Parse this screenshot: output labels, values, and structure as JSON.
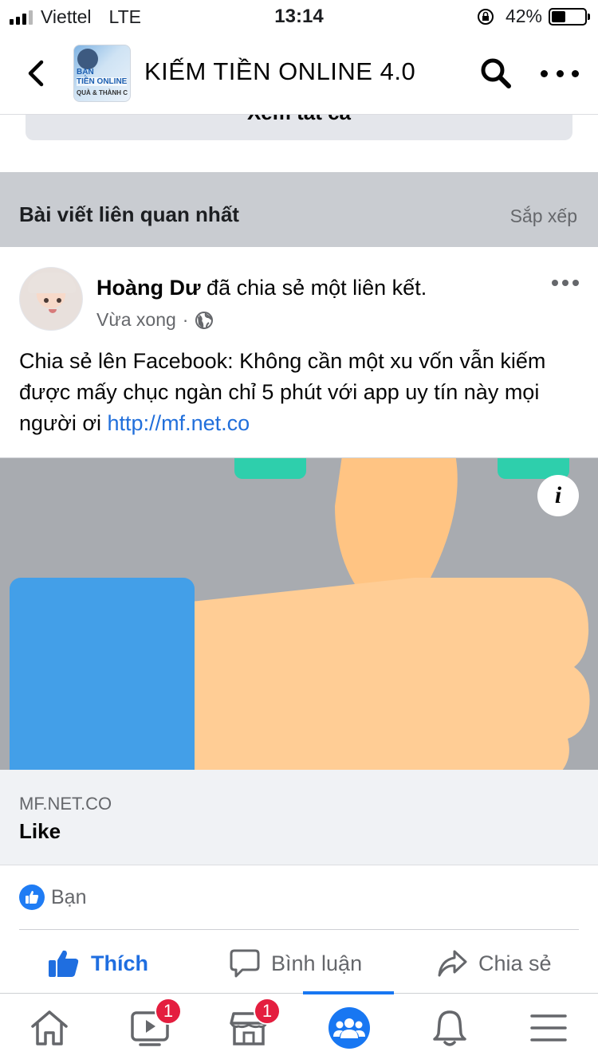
{
  "status_bar": {
    "carrier": "Viettel",
    "network": "LTE",
    "time": "13:14",
    "battery_percent": "42%",
    "battery_level": 0.42
  },
  "header": {
    "group_name": "KIẾM TIỀN ONLINE 4.0",
    "thumb_line1": "BẠN",
    "thumb_line2": "TIỀN ONLINE",
    "thumb_line3": "QUÀ & THÀNH C"
  },
  "see_all": {
    "label": "Xem tất cả"
  },
  "section": {
    "title": "Bài viết liên quan nhất",
    "sort_label": "Sắp xếp"
  },
  "post": {
    "author": "Hoàng Dư",
    "action": " đã chia sẻ một liên kết.",
    "time": "Vừa xong",
    "text": "Chia sẻ lên Facebook: Không cần một xu vốn vẫn kiếm được mấy chục ngàn chỉ 5 phút với app uy tín này mọi người ơi ",
    "link_text": "http://mf.net.co",
    "preview": {
      "domain": "MF.NET.CO",
      "title": "Like"
    },
    "reactions_text": "Bạn"
  },
  "actions": {
    "like": "Thích",
    "comment": "Bình luận",
    "share": "Chia sẻ"
  },
  "tabs": {
    "watch_badge": "1",
    "marketplace_badge": "1"
  },
  "colors": {
    "accent": "#1877f2",
    "link": "#216fdb",
    "badge": "#e41e3f",
    "section_bg": "#c9ccd1"
  },
  "icons": [
    "back-icon",
    "search-icon",
    "more-icon",
    "globe-icon",
    "info-icon",
    "like-icon",
    "comment-icon",
    "share-icon",
    "home-icon",
    "watch-icon",
    "marketplace-icon",
    "groups-icon",
    "bell-icon",
    "menu-icon"
  ]
}
